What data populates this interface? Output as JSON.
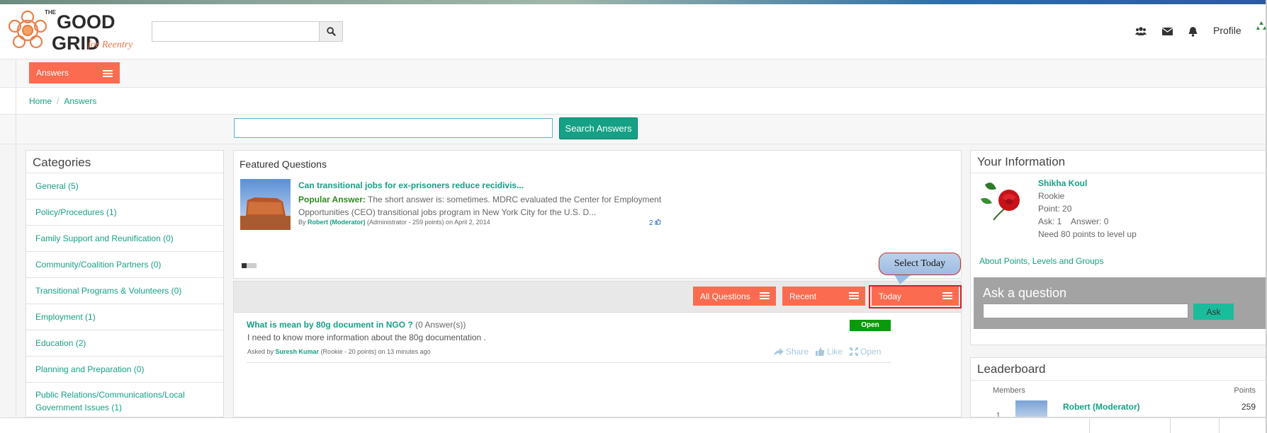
{
  "header": {
    "logo": {
      "line1": "THE",
      "line2": "GOOD",
      "line3": "GRID",
      "tagline": "for Reentry"
    },
    "search": {
      "placeholder": "",
      "button_icon": "search-icon"
    },
    "icons": [
      "users-icon",
      "envelope-icon",
      "bell-icon"
    ],
    "profile_label": "Profile"
  },
  "section_nav": {
    "dropdown_label": "Answers"
  },
  "breadcrumb": {
    "items": [
      "Home",
      "Answers"
    ]
  },
  "answer_search": {
    "input_value": "",
    "button_label": "Search Answers"
  },
  "categories": {
    "title": "Categories",
    "items": [
      "General (5)",
      "Policy/Procedures (1)",
      "Family Support and Reunification (0)",
      "Community/Coalition Partners (0)",
      "Transitional Programs & Volunteers (0)",
      "Employment (1)",
      "Education (2)",
      "Planning and Preparation (0)",
      "Public Relations/Communications/Local Government Issues (1)"
    ]
  },
  "featured": {
    "title": "Featured Questions",
    "question_title": "Can transitional jobs for ex-prisoners reduce recidivis...",
    "answer_label": "Popular Answer:",
    "answer_text": " The short answer is: sometimes. MDRC evaluated the Center for Employment Opportunities (CEO) transitional jobs program in New York City for the U.S. D...",
    "by_label": "By ",
    "author": "Robert (Moderator)",
    "author_role": " (Administrator - 259 points)  on April 2, 2014",
    "like_count": "2"
  },
  "filters": {
    "all_questions": "All Questions",
    "recent": "Recent",
    "today": "Today",
    "callout": "Select Today"
  },
  "questions": [
    {
      "title": "What is mean by 80g document in NGO ?",
      "answer_count": " (0 Answer(s))",
      "status": "Open",
      "description": "I need to know more information about the 80g documentation .",
      "asked_by_label": "Asked by ",
      "author": "Suresh Kumar",
      "meta": " (Rookie - 20 points)  on 13 minutes ago",
      "actions": {
        "share": "Share",
        "like": "Like",
        "open": "Open"
      }
    }
  ],
  "your_information": {
    "title": "Your Information",
    "name": "Shikha Koul",
    "level": "Rookie",
    "points": "Point: 20",
    "ask_answer": "Ask: 1    Answer: 0",
    "next_level": "Need 80 points to level up",
    "about_link": "About Points, Levels and Groups"
  },
  "ask_question": {
    "title": "Ask a question",
    "input_value": "",
    "button_label": "Ask"
  },
  "leaderboard": {
    "title": "Leaderboard",
    "col_members": "Members",
    "col_points": "Points",
    "rows": [
      {
        "rank": "1",
        "name": "Robert (Moderator)",
        "points": "259"
      }
    ]
  },
  "colors": {
    "accent_orange": "#fb6b4f",
    "accent_teal": "#16a085",
    "status_green": "#0a9a0a",
    "callout_border": "#d02030"
  }
}
